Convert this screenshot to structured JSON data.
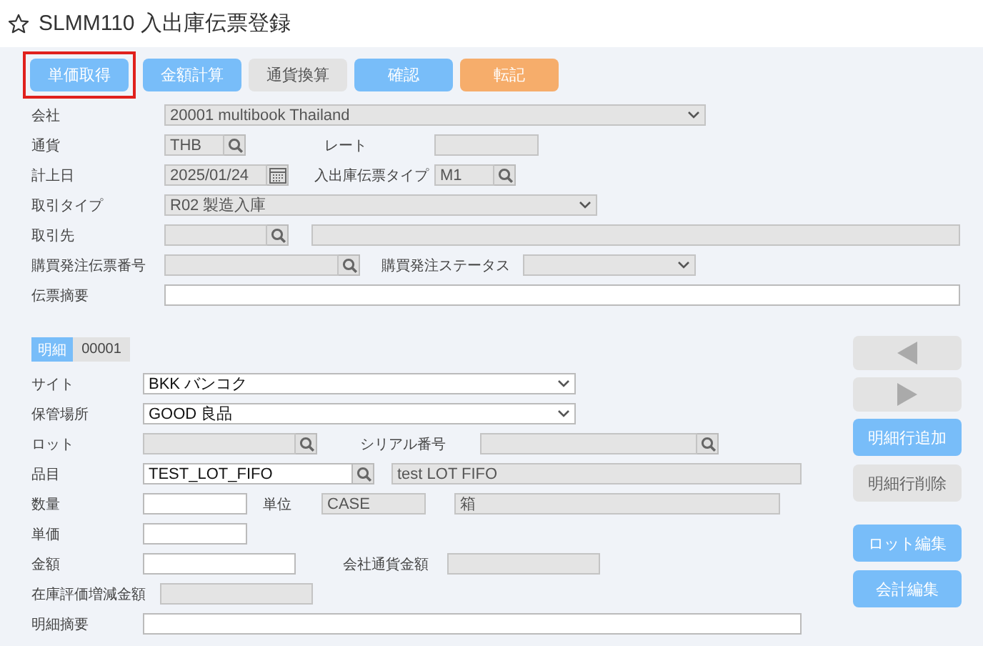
{
  "window": {
    "title": "SLMM110 入出庫伝票登録",
    "favorite": false
  },
  "toolbar": [
    {
      "label": "単価取得",
      "kind": "primary",
      "highlighted": true
    },
    {
      "label": "金額計算",
      "kind": "primary",
      "highlighted": false
    },
    {
      "label": "通貨換算",
      "kind": "disabled",
      "highlighted": false
    },
    {
      "label": "確認",
      "kind": "primary",
      "highlighted": false
    },
    {
      "label": "転記",
      "kind": "accent",
      "highlighted": false
    }
  ],
  "header": [
    {
      "items": [
        {
          "label": "会社",
          "kind": "select",
          "value": "20001 multibook Thailand",
          "disabled": true
        }
      ]
    },
    {
      "items": [
        {
          "label": "通貨",
          "kind": "lookup",
          "value": "THB",
          "disabled": true
        },
        {
          "label": "レート",
          "kind": "text",
          "disabled": true
        }
      ]
    },
    {
      "items": [
        {
          "label": "計上日",
          "kind": "date",
          "value": "2025/01/24",
          "disabled": true
        },
        {
          "label": "入出庫伝票タイプ",
          "kind": "lookup",
          "value": "M1",
          "disabled": true
        }
      ]
    },
    {
      "items": [
        {
          "label": "取引タイプ",
          "kind": "select",
          "value": "R02 製造入庫",
          "disabled": true
        }
      ]
    },
    {
      "items": [
        {
          "label": "取引先",
          "kind": "lookup",
          "disabled": true
        },
        {
          "kind": "text",
          "disabled": true
        }
      ]
    },
    {
      "items": [
        {
          "label": "購買発注伝票番号",
          "kind": "lookup",
          "disabled": true
        },
        {
          "label": "購買発注ステータス",
          "kind": "select",
          "disabled": true
        }
      ]
    },
    {
      "items": [
        {
          "label": "伝票摘要",
          "kind": "text",
          "disabled": false
        }
      ]
    }
  ],
  "detail": {
    "label": "明細",
    "line_no": "00001",
    "rows": [
      {
        "items": [
          {
            "label": "サイト",
            "kind": "select",
            "value": "BKK バンコク",
            "disabled": false
          }
        ]
      },
      {
        "items": [
          {
            "label": "保管場所",
            "kind": "select",
            "value": "GOOD 良品",
            "disabled": false
          }
        ]
      },
      {
        "items": [
          {
            "label": "ロット",
            "kind": "lookup",
            "disabled": true
          },
          {
            "label": "シリアル番号",
            "kind": "lookup",
            "disabled": true
          }
        ]
      },
      {
        "items": [
          {
            "label": "品目",
            "kind": "lookup",
            "value": "TEST_LOT_FIFO",
            "disabled": false
          },
          {
            "kind": "text",
            "value": "test LOT FIFO",
            "disabled": true
          }
        ]
      },
      {
        "items": [
          {
            "label": "数量",
            "kind": "text",
            "disabled": false
          },
          {
            "label": "単位",
            "kind": "text",
            "value": "CASE",
            "disabled": true
          },
          {
            "kind": "text",
            "value": "箱",
            "disabled": true
          }
        ]
      },
      {
        "items": [
          {
            "label": "単価",
            "kind": "text",
            "disabled": false
          }
        ]
      },
      {
        "items": [
          {
            "label": "金額",
            "kind": "text",
            "disabled": false
          },
          {
            "label": "会社通貨金額",
            "kind": "text",
            "disabled": true
          }
        ]
      },
      {
        "items": [
          {
            "label": "在庫評価増減金額",
            "kind": "text",
            "disabled": true
          }
        ]
      },
      {
        "items": [
          {
            "label": "明細摘要",
            "kind": "text",
            "disabled": false
          }
        ]
      }
    ]
  },
  "side_buttons": [
    {
      "kind": "prev",
      "disabled": true
    },
    {
      "kind": "next",
      "disabled": true
    },
    {
      "kind": "label",
      "label": "明細行追加",
      "disabled": false
    },
    {
      "kind": "label",
      "label": "明細行削除",
      "disabled": true
    },
    {
      "kind": "label",
      "label": "ロット編集",
      "disabled": false
    },
    {
      "kind": "label",
      "label": "会計編集",
      "disabled": false
    }
  ]
}
